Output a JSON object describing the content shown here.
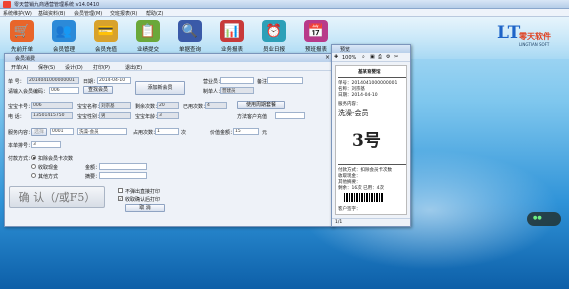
{
  "window": {
    "title": "零天营销九商通营管理系统 v14.0410"
  },
  "menu": [
    "系统维护(W)",
    "基础资料(B)",
    "会员管理(M)",
    "交班报表(R)",
    "帮助(Z)"
  ],
  "toolbar": [
    {
      "label": "先前开单",
      "icon": "cart-icon",
      "color": "#e8652a"
    },
    {
      "label": "会员管理",
      "icon": "members-icon",
      "color": "#2c8ad8"
    },
    {
      "label": "会员充值",
      "icon": "card-icon",
      "color": "#d8a22c"
    },
    {
      "label": "业绩提交",
      "icon": "clipboard-icon",
      "color": "#6aa83a"
    },
    {
      "label": "单据查询",
      "icon": "search-doc-icon",
      "color": "#3a5aa8"
    },
    {
      "label": "业务报表",
      "icon": "report-icon",
      "color": "#c83a3a"
    },
    {
      "label": "员业日报",
      "icon": "clock-icon",
      "color": "#2ca0b8"
    },
    {
      "label": "预班报表",
      "icon": "calendar-icon",
      "color": "#b83a8a"
    }
  ],
  "logo": {
    "mark": "LT",
    "name": "零天软件",
    "tagline": "LINGTIAN SOFT"
  },
  "dialog": {
    "title": "会员消费",
    "tools": [
      "开单(A)",
      "保存(S)",
      "设计(D)",
      "打印(P)",
      "退出(E)"
    ],
    "fields": {
      "order_label": "单  号：",
      "order_value": "2014041000000001",
      "date_label": "日期：",
      "date_value": "2014-04-10",
      "input_member_label": "请输入会员编码：",
      "input_member_value": "006",
      "member_btn": "查找会员",
      "member_add": "添加新会员",
      "salesman_label": "营业员：",
      "note_label": "备注：",
      "maker_label": "制单人：",
      "maker_value": "营建员",
      "card_label": "宝宝卡号：",
      "card_value": "006",
      "name_label": "宝宝名称：",
      "name_value": "刘宗基",
      "remain_label": "剩余次数：",
      "remain_value": "20",
      "used_label": "已用次数：",
      "used_value": "4",
      "phone_label": "电    话：",
      "phone_value": "13501415750",
      "sex_label": "宝宝性别：",
      "sex_value": "男",
      "age_label": "宝宝年龄：",
      "age_value": "3",
      "service_btn": "使用周期套餐",
      "member_plan": "方法客户充值",
      "service_label": "服务内容：",
      "service_btn2": "选择",
      "service_code": "0001",
      "service_name": "洗澡-会员",
      "times_label": "占用次数：",
      "times_value": "1",
      "times_unit": "次",
      "price_label": "价值金额：",
      "price_value": "15",
      "price_unit": "元",
      "bill_label": "本单排号：",
      "bill_value": "3",
      "pay_label": "付款方式：",
      "pay_opts": [
        "扣除会员卡次数",
        "收取现金",
        "其他方式"
      ],
      "amount_label": "金额：",
      "remark_label": "摘要：",
      "confirm": "确  认（/或F5）",
      "opt_noprint": "不弹出直接打印",
      "opt_printafter": "收取确认后打印",
      "cancel": "取  消"
    }
  },
  "preview": {
    "title": "预览",
    "zoom": "100%",
    "shop": "基某育婴馆",
    "lines": [
      "单号：2014041000000001",
      "名称：刘宗基",
      "日期：2014-04-10",
      "服务内容："
    ],
    "service": "洗澡-会员",
    "number": "3号",
    "footer": [
      "付款方式：扣除会员卡次数",
      "收取现金：",
      "其他摘要：",
      "剩余：16次 已用：4次"
    ],
    "sign": "客户签字：",
    "page": "1/1"
  }
}
